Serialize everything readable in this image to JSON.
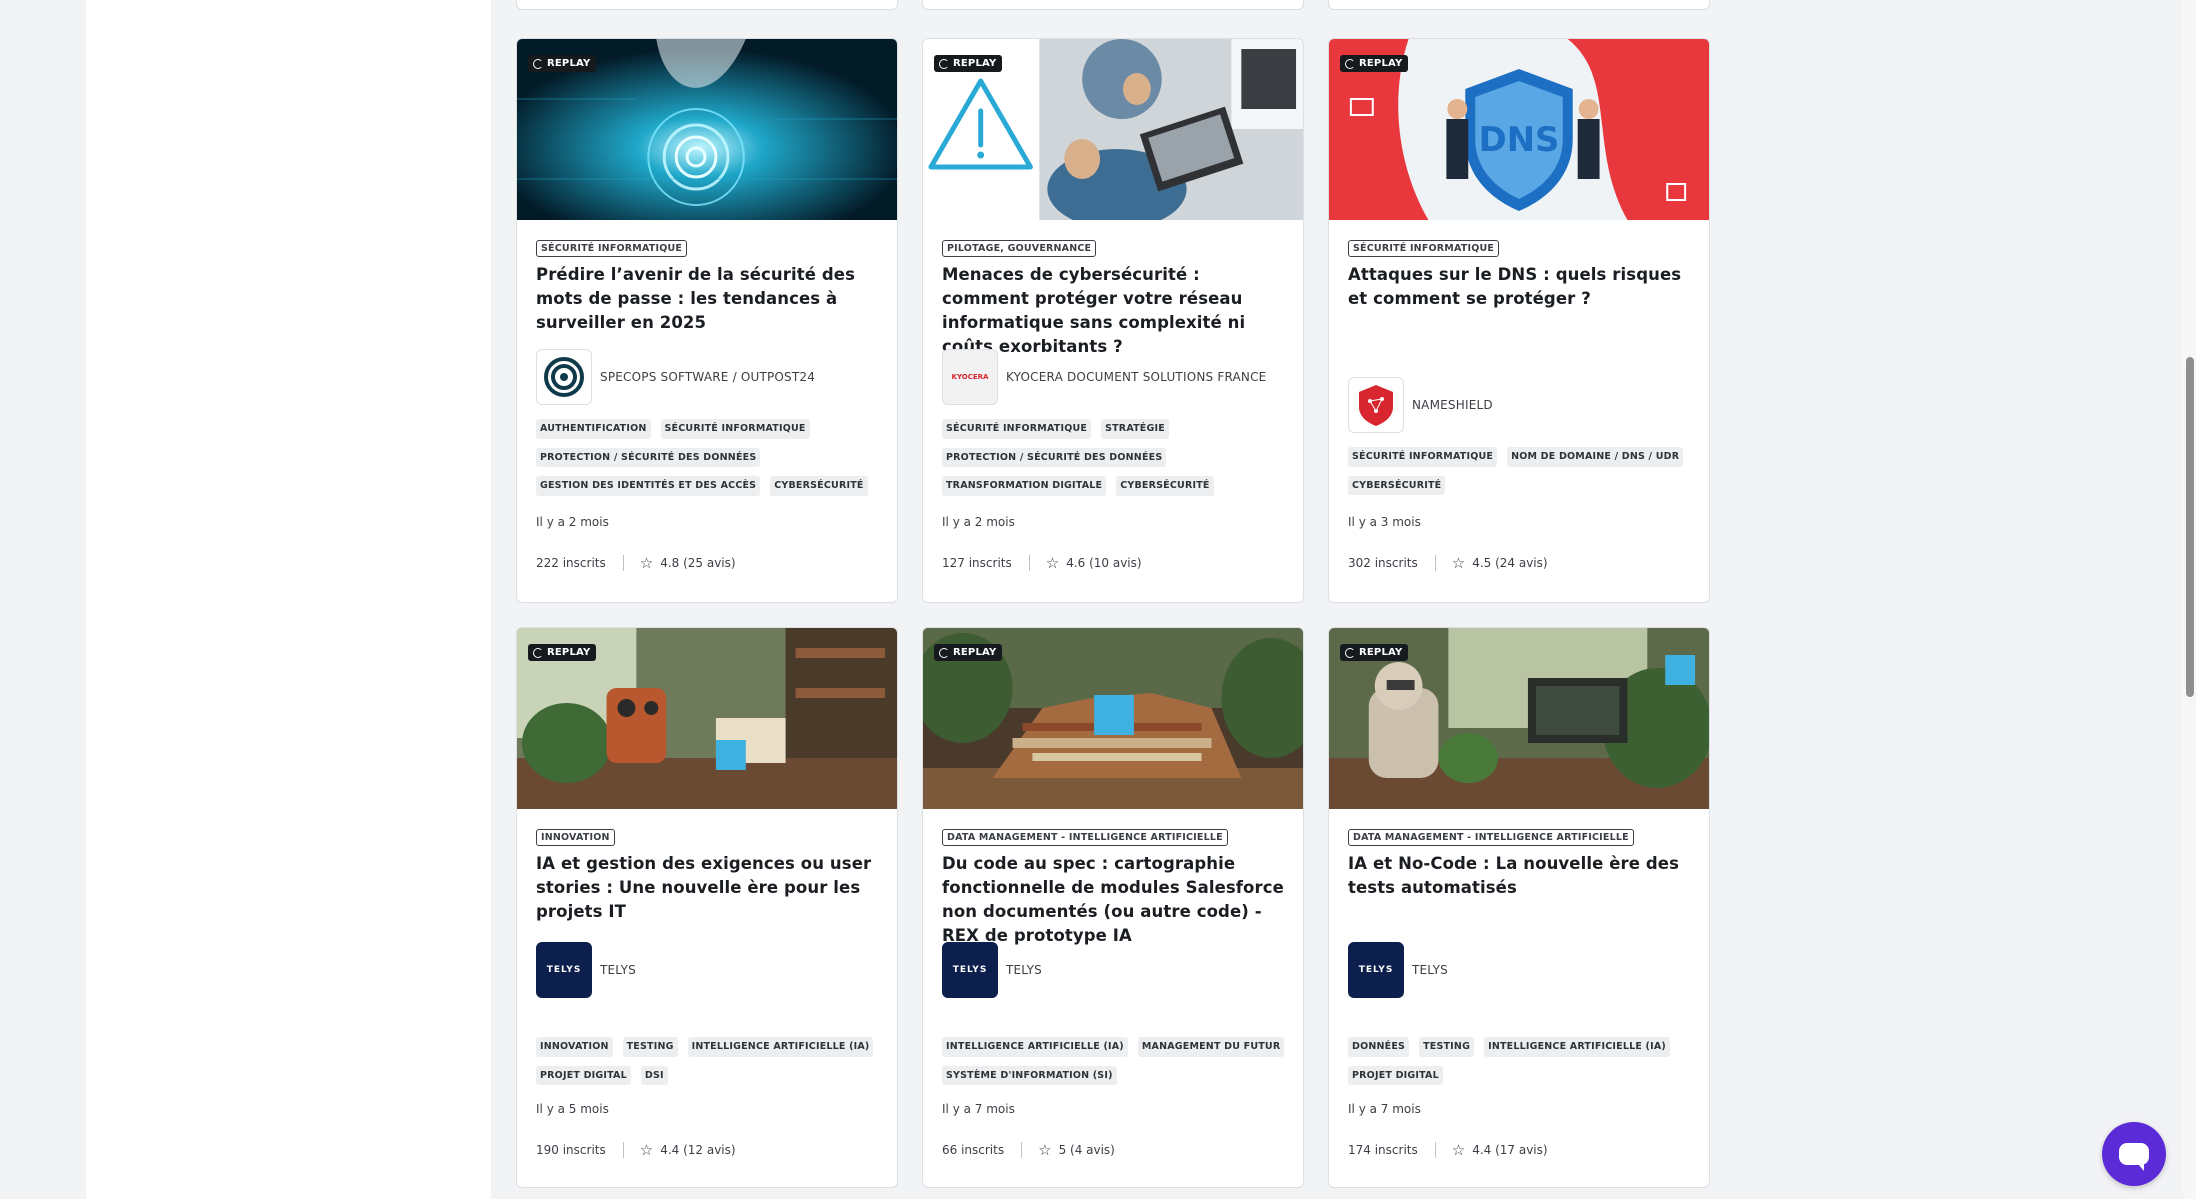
{
  "replay_label": "REPLAY",
  "cards": [
    {
      "category": "SÉCURITÉ INFORMATIQUE",
      "title": "Prédire l’avenir de la sécurité des mots de passe : les tendances à surveiller en 2025",
      "org": "SPECOPS SOFTWARE / OUTPOST24",
      "tags": [
        "AUTHENTIFICATION",
        "SÉCURITÉ INFORMATIQUE",
        "PROTECTION / SÉCURITÉ DES DONNÉES",
        "GESTION DES IDENTITÉS ET DES ACCÈS",
        "CYBERSÉCURITÉ"
      ],
      "date": "Il y a 2 mois",
      "subscribers": "222 inscrits",
      "rating": "4.8 (25 avis)"
    },
    {
      "category": "PILOTAGE, GOUVERNANCE",
      "title": "Menaces de cybersécurité : comment protéger votre réseau informatique sans complexité ni coûts exorbitants ?",
      "org": "KYOCERA DOCUMENT SOLUTIONS FRANCE",
      "logo_text": "KYOCERA",
      "tags": [
        "SÉCURITÉ INFORMATIQUE",
        "STRATÉGIE",
        "PROTECTION / SÉCURITÉ DES DONNÉES",
        "TRANSFORMATION DIGITALE",
        "CYBERSÉCURITÉ"
      ],
      "date": "Il y a 2 mois",
      "subscribers": "127 inscrits",
      "rating": "4.6 (10 avis)"
    },
    {
      "category": "SÉCURITÉ INFORMATIQUE",
      "title": "Attaques sur le DNS : quels risques et comment se protéger ?",
      "org": "NAMESHIELD",
      "thumb_text": "DNS",
      "tags": [
        "SÉCURITÉ INFORMATIQUE",
        "NOM DE DOMAINE / DNS / UDR",
        "CYBERSÉCURITÉ"
      ],
      "date": "Il y a 3 mois",
      "subscribers": "302 inscrits",
      "rating": "4.5 (24 avis)"
    },
    {
      "category": "INNOVATION",
      "title": "IA et gestion des exigences ou user stories : Une nouvelle ère pour les projets IT",
      "org": "TELYS",
      "logo_text": "TELYS",
      "tags": [
        "INNOVATION",
        "TESTING",
        "INTELLIGENCE ARTIFICIELLE (IA)",
        "PROJET DIGITAL",
        "DSI"
      ],
      "date": "Il y a 5 mois",
      "subscribers": "190 inscrits",
      "rating": "4.4 (12 avis)"
    },
    {
      "category": "DATA MANAGEMENT - INTELLIGENCE ARTIFICIELLE",
      "title": "Du code au spec : cartographie fonctionnelle de modules Salesforce non documentés (ou autre code) - REX de prototype IA",
      "org": "TELYS",
      "logo_text": "TELYS",
      "tags": [
        "INTELLIGENCE ARTIFICIELLE (IA)",
        "MANAGEMENT DU FUTUR",
        "SYSTÈME D'INFORMATION (SI)"
      ],
      "date": "Il y a 7 mois",
      "subscribers": "66 inscrits",
      "rating": "5 (4 avis)"
    },
    {
      "category": "DATA MANAGEMENT - INTELLIGENCE ARTIFICIELLE",
      "title": "IA et No-Code : La nouvelle ère des tests automatisés",
      "org": "TELYS",
      "logo_text": "TELYS",
      "tags": [
        "DONNÉES",
        "TESTING",
        "INTELLIGENCE ARTIFICIELLE (IA)",
        "PROJET DIGITAL"
      ],
      "date": "Il y a 7 mois",
      "subscribers": "174 inscrits",
      "rating": "4.4 (17 avis)"
    }
  ],
  "icons": {
    "replay": "replay-icon",
    "star": "star-outline-icon",
    "chat": "chat-bubble-icon"
  },
  "colors": {
    "accent_chat": "#5b2bd8",
    "telys_logo": "#0d1f4c",
    "dns_red": "#e8373d",
    "nameshield_red": "#d8262f"
  }
}
